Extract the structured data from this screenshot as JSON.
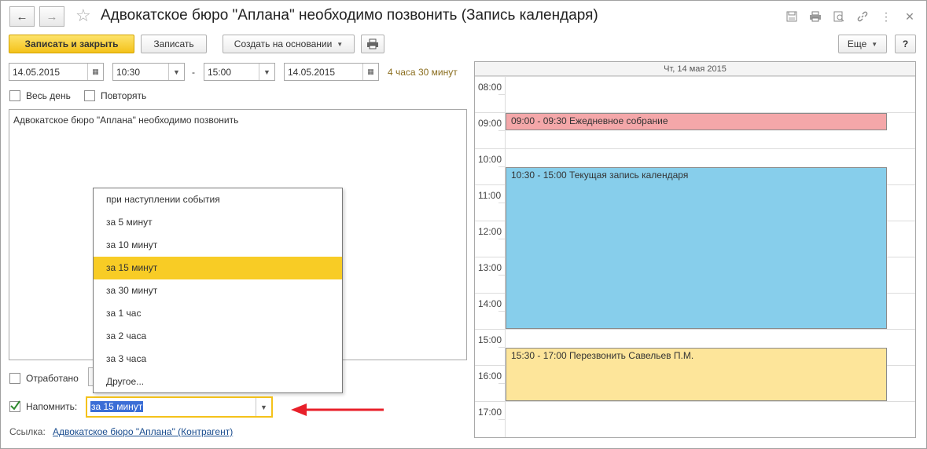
{
  "window": {
    "title": "Адвокатское бюро \"Аплана\" необходимо позвонить (Запись календаря)"
  },
  "toolbar": {
    "save_close_label": "Записать и закрыть",
    "save_label": "Записать",
    "create_based_label": "Создать на основании",
    "more_label": "Еще",
    "help_label": "?"
  },
  "dates": {
    "start_date": "14.05.2015",
    "start_time": "10:30",
    "dash": "-",
    "end_time": "15:00",
    "end_date": "14.05.2015",
    "duration": "4 часа 30 минут"
  },
  "options": {
    "all_day_label": "Весь день",
    "repeat_label": "Повторять"
  },
  "description": {
    "text": "Адвокатское бюро \"Аплана\" необходимо позвонить"
  },
  "bottom": {
    "worked_label": "Отработано",
    "remind_label": "Напомнить:",
    "remind_value": "за 15 минут",
    "link_label": "Ссылка:",
    "link_value": "Адвокатское бюро \"Аплана\" (Контрагент)"
  },
  "dropdown": {
    "items": [
      {
        "label": "при наступлении события"
      },
      {
        "label": "за 5 минут"
      },
      {
        "label": "за 10 минут"
      },
      {
        "label": "за 15 минут"
      },
      {
        "label": "за 30 минут"
      },
      {
        "label": "за 1 час"
      },
      {
        "label": "за 2 часа"
      },
      {
        "label": "за 3 часа"
      },
      {
        "label": "Другое..."
      }
    ],
    "selected": "за 15 минут"
  },
  "calendar": {
    "header": "Чт, 14 мая 2015",
    "hours": [
      "08:00",
      "09:00",
      "10:00",
      "11:00",
      "12:00",
      "13:00",
      "14:00",
      "15:00",
      "16:00",
      "17:00"
    ],
    "events": [
      {
        "label": "09:00 - 09:30 Ежедневное собрание",
        "start": "09:00",
        "end": "09:30",
        "color": "#f4a7a9"
      },
      {
        "label": "10:30 - 15:00 Текущая запись календаря",
        "start": "10:30",
        "end": "15:00",
        "color": "#87ceeb"
      },
      {
        "label": "15:30 - 17:00 Перезвонить Савельев П.М.",
        "start": "15:30",
        "end": "17:00",
        "color": "#fde59a"
      }
    ]
  },
  "colors": {
    "accent_yellow": "#f4c21a",
    "arrow_red": "#e8202a",
    "selection_blue": "#3b6ed6"
  }
}
